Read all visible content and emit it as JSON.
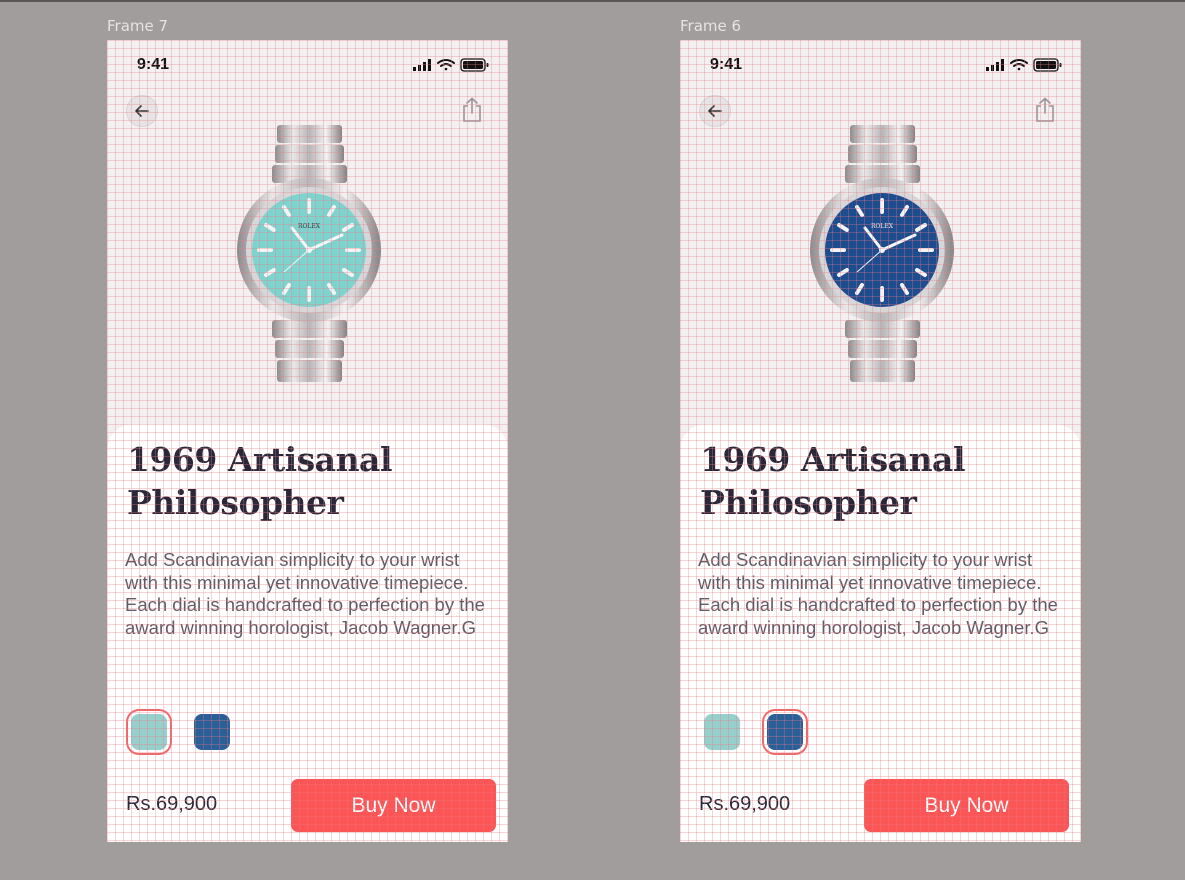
{
  "canvas": {
    "background": "#a19d9d"
  },
  "frames": [
    {
      "label": "Frame 7",
      "status_time": "9:41",
      "dial_color": "#7fd3cf",
      "dial_accent": "#4fb7b2",
      "product_title_line1": "1969 Artisanal",
      "product_title_line2": "Philosopher",
      "description": "Add Scandinavian simplicity to your wrist with this minimal yet innovative timepiece. Each dial is handcrafted to perfection by the award winning horologist, Jacob Wagner.G",
      "swatches": [
        {
          "name": "teal",
          "color": "#96cfcc",
          "selected": true
        },
        {
          "name": "blue",
          "color": "#2b5f98",
          "selected": false
        }
      ],
      "price": "Rs.69,900",
      "buy_label": "Buy Now",
      "buy_color": "#fb5556"
    },
    {
      "label": "Frame 6",
      "status_time": "9:41",
      "dial_color": "#1d4c8f",
      "dial_accent": "#123a73",
      "product_title_line1": "1969 Artisanal",
      "product_title_line2": "Philosopher",
      "description": "Add Scandinavian simplicity to your wrist with this minimal yet innovative timepiece. Each dial is handcrafted to perfection by the award winning horologist, Jacob Wagner.G",
      "swatches": [
        {
          "name": "teal",
          "color": "#96cfcc",
          "selected": false
        },
        {
          "name": "blue",
          "color": "#2b5f98",
          "selected": true
        }
      ],
      "price": "Rs.69,900",
      "buy_label": "Buy Now",
      "buy_color": "#fb5556"
    }
  ],
  "icons": {
    "back": "arrow-left-icon",
    "share": "share-icon",
    "signal": "cellular-signal-icon",
    "wifi": "wifi-icon",
    "battery": "battery-icon"
  },
  "watch_brand": "ROLEX"
}
